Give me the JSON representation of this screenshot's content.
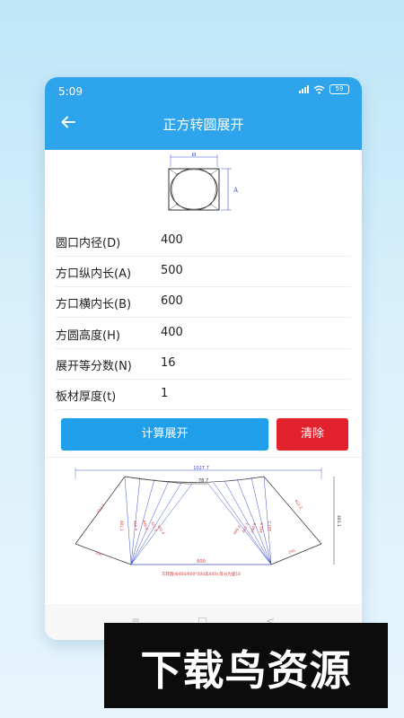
{
  "status": {
    "time": "5:09",
    "battery": "59"
  },
  "header": {
    "title": "正方转圆展开"
  },
  "top_diagram": {
    "label_b": "B",
    "label_a": "A"
  },
  "fields": [
    {
      "label": "圆口内径(D)",
      "value": "400"
    },
    {
      "label": "方口纵内长(A)",
      "value": "500"
    },
    {
      "label": "方口横内长(B)",
      "value": "600"
    },
    {
      "label": "方圆高度(H)",
      "value": "400"
    },
    {
      "label": "展开等分数(N)",
      "value": "16"
    },
    {
      "label": "板材厚度(t)",
      "value": "1"
    }
  ],
  "buttons": {
    "calculate": "计算展开",
    "clear": "清除"
  },
  "unfold_diagram": {
    "total_width": "1027.7",
    "top_width": "78.7",
    "bottom_width": "600",
    "right_height": "481.1",
    "left_slant": "412.2",
    "right_slant": "412.2",
    "left_base": "250",
    "right_base": "250",
    "left_lines": [
      "481.1",
      "465.5",
      "448.6",
      "421.3",
      "400.4"
    ],
    "right_lines": [
      "400.4",
      "421.3",
      "448.6",
      "465.5",
      "481.1"
    ],
    "caption": "方转圆(Φ400/600*500高400),等分为面16"
  },
  "watermark": {
    "text": "下载鸟资源"
  },
  "colors": {
    "primary": "#2da4ec",
    "calc_button": "#1f9eea",
    "clear_button": "#e3222d",
    "dim_blue": "#3d4fd1",
    "dim_red": "#d43a3a"
  }
}
